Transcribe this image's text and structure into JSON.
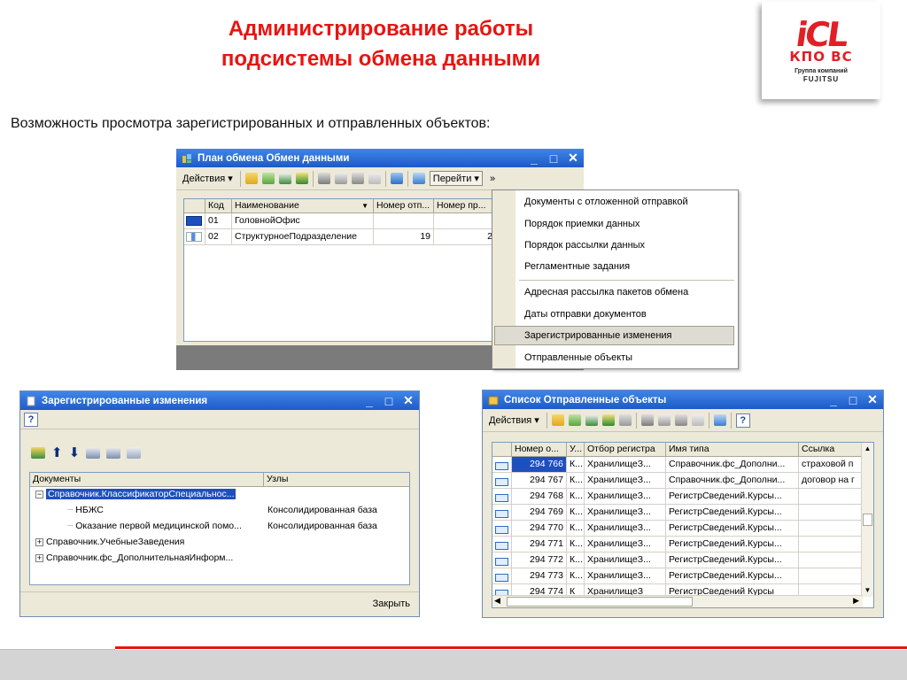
{
  "slide": {
    "title_line1": "Администрирование работы",
    "title_line2": "подсистемы обмена данными",
    "subtitle": "Возможность просмотра зарегистрированных и отправленных объектов:"
  },
  "logo": {
    "brand": "iCL",
    "sub": "КПО ВС",
    "group": "Группа компаний",
    "partner": "FUJITSU"
  },
  "colors": {
    "accent": "#e8140f",
    "titlebar": "#2563d1",
    "window_bg": "#ece9d8"
  },
  "win1": {
    "title": "План обмена Обмен данными",
    "toolbar": {
      "actions": "Действия ▾",
      "goto": "Перейти ▾",
      "more": "»"
    },
    "headers": [
      "Код",
      "Наименование",
      "Номер отп...",
      "Номер пр..."
    ],
    "rows": [
      {
        "code": "01",
        "name": "ГоловнойОфис",
        "sent": "",
        "received": ""
      },
      {
        "code": "02",
        "name": "СтруктурноеПодразделение",
        "sent": "19",
        "received": "2"
      }
    ]
  },
  "menu": {
    "items": [
      "Документы с отложенной отправкой",
      "Порядок приемки данных",
      "Порядок рассылки данных",
      "Регламентные задания",
      "Адресная рассылка пакетов обмена",
      "Даты отправки документов",
      "Зарегистрированные изменения",
      "Отправленные объекты"
    ],
    "highlighted": "Зарегистрированные изменения"
  },
  "win2": {
    "title": "Зарегистрированные изменения",
    "help": "?",
    "headers": [
      "Документы",
      "Узлы"
    ],
    "tree": [
      {
        "label": "Справочник.КлассификаторСпециальнос...",
        "node": "",
        "expand": "−"
      },
      {
        "label": "НБЖС",
        "node": "Консолидированная база",
        "expand": ""
      },
      {
        "label": "Оказание первой медицинской помо...",
        "node": "Консолидированная база",
        "expand": ""
      },
      {
        "label": "Справочник.УчебныеЗаведения",
        "node": "",
        "expand": "+"
      },
      {
        "label": "Справочник.фс_ДополнительнаяИнформ...",
        "node": "",
        "expand": "+"
      }
    ],
    "close": "Закрыть"
  },
  "win3": {
    "title": "Список Отправленные объекты",
    "toolbar": {
      "actions": "Действия ▾",
      "help": "?"
    },
    "headers": [
      "Номер о...",
      "У...",
      "Отбор регистра",
      "Имя типа",
      "Ссылка"
    ],
    "rows": [
      {
        "num": "294 766",
        "u": "К...",
        "reg": "ХранилищеЗ...",
        "type": "Справочник.фс_Дополни...",
        "ref": "страховой п"
      },
      {
        "num": "294 767",
        "u": "К...",
        "reg": "ХранилищеЗ...",
        "type": "Справочник.фс_Дополни...",
        "ref": "договор на г"
      },
      {
        "num": "294 768",
        "u": "К...",
        "reg": "ХранилищеЗ...",
        "type": "РегистрСведений.Курсы...",
        "ref": ""
      },
      {
        "num": "294 769",
        "u": "К...",
        "reg": "ХранилищеЗ...",
        "type": "РегистрСведений.Курсы...",
        "ref": ""
      },
      {
        "num": "294 770",
        "u": "К...",
        "reg": "ХранилищеЗ...",
        "type": "РегистрСведений.Курсы...",
        "ref": ""
      },
      {
        "num": "294 771",
        "u": "К...",
        "reg": "ХранилищеЗ...",
        "type": "РегистрСведений.Курсы...",
        "ref": ""
      },
      {
        "num": "294 772",
        "u": "К...",
        "reg": "ХранилищеЗ...",
        "type": "РегистрСведений.Курсы...",
        "ref": ""
      },
      {
        "num": "294 773",
        "u": "К...",
        "reg": "ХранилищеЗ...",
        "type": "РегистрСведений.Курсы...",
        "ref": ""
      },
      {
        "num": "294 774",
        "u": "К",
        "reg": "ХранилищеЗ",
        "type": "РегистрСведений Курсы",
        "ref": ""
      }
    ]
  }
}
